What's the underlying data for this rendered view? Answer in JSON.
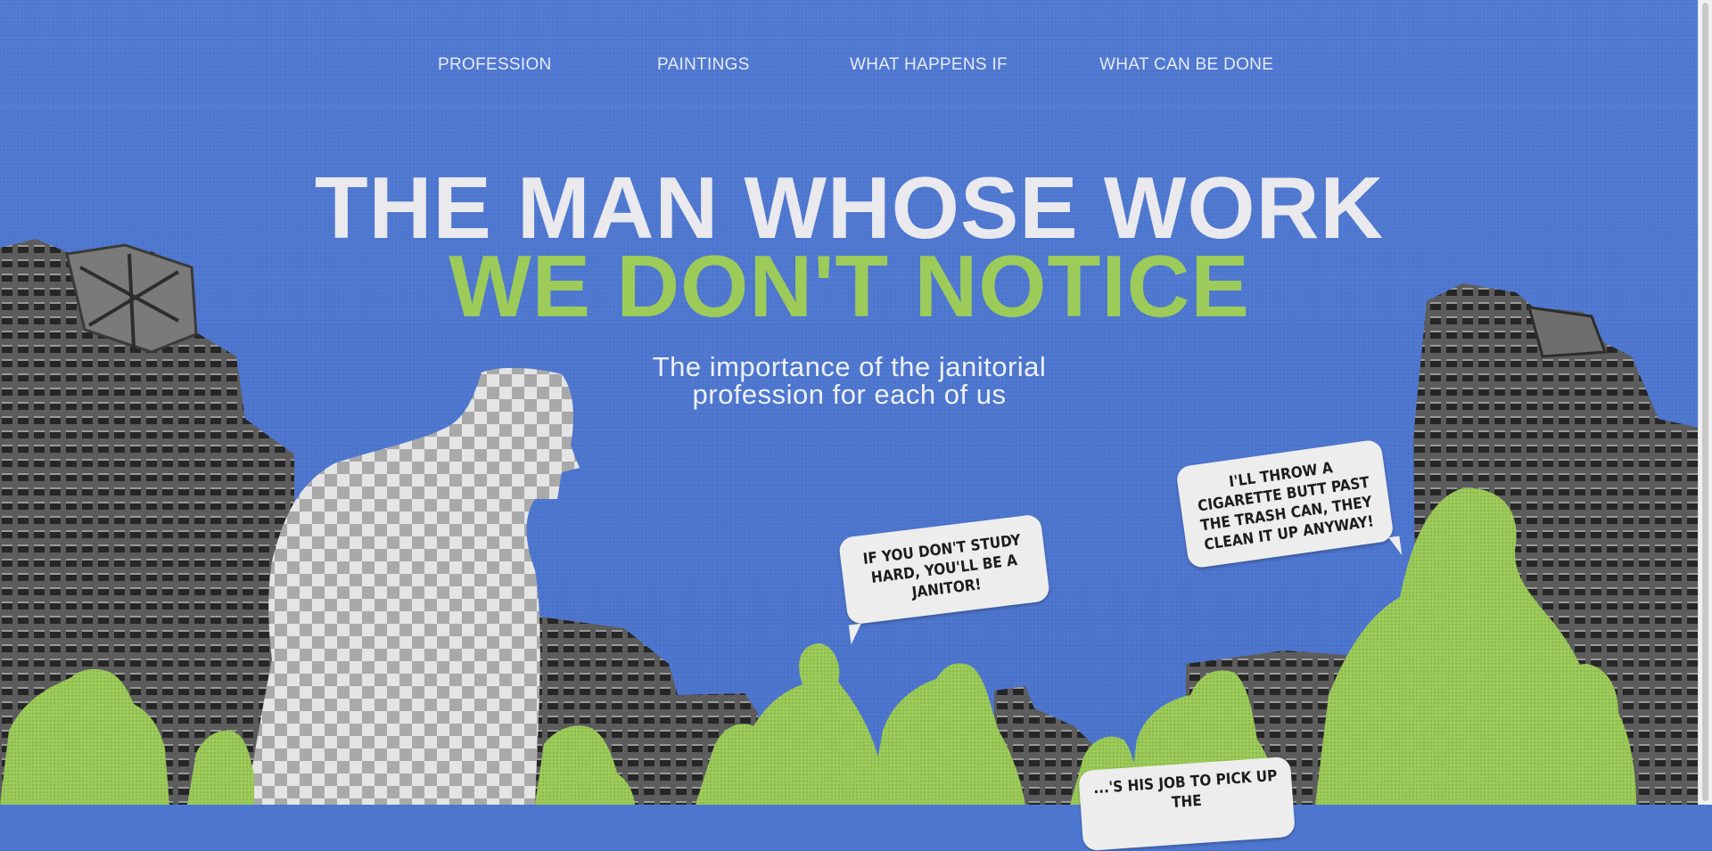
{
  "nav": {
    "items": [
      {
        "label": "PROFESSION"
      },
      {
        "label": "PAINTINGS"
      },
      {
        "label": "WHAT HAPPENS IF"
      },
      {
        "label": "WHAT CAN BE DONE"
      }
    ]
  },
  "hero": {
    "title_line1": "THE MAN WHOSE WORK",
    "title_line2": "WE DON'T NOTICE",
    "subtitle_line1": "The importance of the janitorial",
    "subtitle_line2": "profession for each of us"
  },
  "bubbles": {
    "study": "If you don't study hard, you'll be a janitor!",
    "cigarette": "I'll throw a cigarette butt past the trash can, they clean it up anyway!",
    "partial": "...'s his job to pick up the"
  },
  "colors": {
    "background": "#4d77cf",
    "accent_green": "#9dcb5a",
    "title_white": "#e9e9ee",
    "building_gray": "#6b6b6b"
  }
}
